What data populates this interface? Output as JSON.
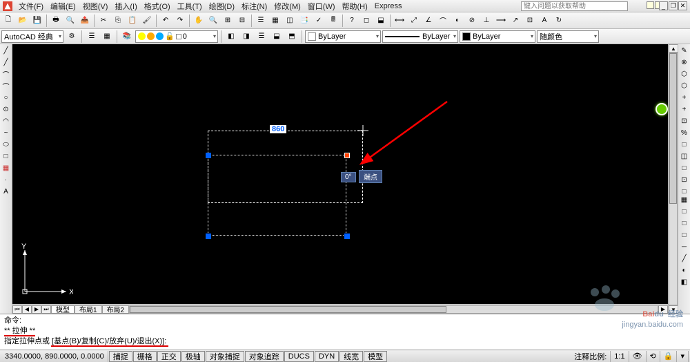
{
  "menu": {
    "items": [
      "文件(F)",
      "编辑(E)",
      "视图(V)",
      "插入(I)",
      "格式(O)",
      "工具(T)",
      "绘图(D)",
      "标注(N)",
      "修改(M)",
      "窗口(W)",
      "帮助(H)",
      "Express"
    ]
  },
  "helpbox_placeholder": "键入问题以获取帮助",
  "workspace_combo": "AutoCAD 经典",
  "layer": {
    "combo": "0",
    "bylayer": "ByLayer"
  },
  "color_combo": "随颜色",
  "canvas": {
    "dim_value": "860",
    "angle_value": "0°",
    "endpoint_label": "端点",
    "ucs": {
      "x": "X",
      "y": "Y"
    }
  },
  "tabs": {
    "model": "模型",
    "layout1": "布局1",
    "layout2": "布局2"
  },
  "cmd": {
    "line1": "命令:",
    "line2": "** 拉伸 **",
    "line3": "指定拉伸点或 [基点(B)/复制(C)/放弃(U)/退出(X)]:"
  },
  "status": {
    "coords": "3340.0000, 890.0000, 0.0000",
    "toggles": [
      "捕捉",
      "栅格",
      "正交",
      "极轴",
      "对象捕捉",
      "对象追踪",
      "DUCS",
      "DYN",
      "线宽",
      "模型"
    ],
    "scale_label": "注释比例:",
    "scale_val": "1:1"
  },
  "watermark": {
    "brand": "经验",
    "sub": "jingyan.baidu.com"
  },
  "icons": {
    "left": [
      "╱",
      "╱",
      "⌒",
      "⌒",
      "○",
      "⊙",
      "◠",
      "~",
      "⬭",
      "□",
      "▦",
      "·",
      "A"
    ],
    "right": [
      "✎",
      "⊗",
      "⬡",
      "⬡",
      "+",
      "+",
      "⊡",
      "%",
      "□",
      "◫",
      "□",
      "⊡",
      "□",
      "╱",
      "─",
      "/",
      "/",
      "─",
      "╱"
    ],
    "right2": [
      "▦",
      "□",
      "□",
      "□",
      "─",
      "╱",
      "◐",
      "◧"
    ]
  }
}
